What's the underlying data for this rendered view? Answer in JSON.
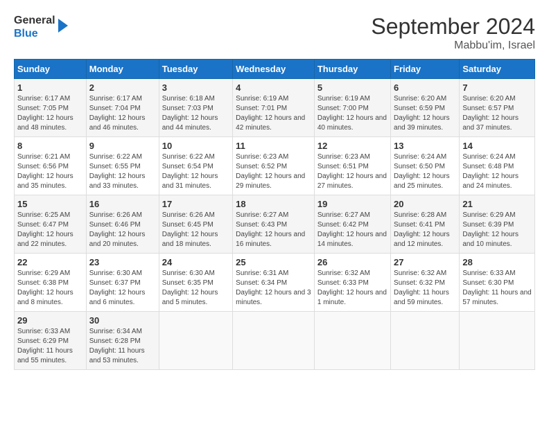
{
  "header": {
    "logo_line1": "General",
    "logo_line2": "Blue",
    "month_title": "September 2024",
    "location": "Mabbu'im, Israel"
  },
  "days_of_week": [
    "Sunday",
    "Monday",
    "Tuesday",
    "Wednesday",
    "Thursday",
    "Friday",
    "Saturday"
  ],
  "weeks": [
    [
      {
        "day": "1",
        "sunrise": "6:17 AM",
        "sunset": "7:05 PM",
        "daylight": "12 hours and 48 minutes."
      },
      {
        "day": "2",
        "sunrise": "6:17 AM",
        "sunset": "7:04 PM",
        "daylight": "12 hours and 46 minutes."
      },
      {
        "day": "3",
        "sunrise": "6:18 AM",
        "sunset": "7:03 PM",
        "daylight": "12 hours and 44 minutes."
      },
      {
        "day": "4",
        "sunrise": "6:19 AM",
        "sunset": "7:01 PM",
        "daylight": "12 hours and 42 minutes."
      },
      {
        "day": "5",
        "sunrise": "6:19 AM",
        "sunset": "7:00 PM",
        "daylight": "12 hours and 40 minutes."
      },
      {
        "day": "6",
        "sunrise": "6:20 AM",
        "sunset": "6:59 PM",
        "daylight": "12 hours and 39 minutes."
      },
      {
        "day": "7",
        "sunrise": "6:20 AM",
        "sunset": "6:57 PM",
        "daylight": "12 hours and 37 minutes."
      }
    ],
    [
      {
        "day": "8",
        "sunrise": "6:21 AM",
        "sunset": "6:56 PM",
        "daylight": "12 hours and 35 minutes."
      },
      {
        "day": "9",
        "sunrise": "6:22 AM",
        "sunset": "6:55 PM",
        "daylight": "12 hours and 33 minutes."
      },
      {
        "day": "10",
        "sunrise": "6:22 AM",
        "sunset": "6:54 PM",
        "daylight": "12 hours and 31 minutes."
      },
      {
        "day": "11",
        "sunrise": "6:23 AM",
        "sunset": "6:52 PM",
        "daylight": "12 hours and 29 minutes."
      },
      {
        "day": "12",
        "sunrise": "6:23 AM",
        "sunset": "6:51 PM",
        "daylight": "12 hours and 27 minutes."
      },
      {
        "day": "13",
        "sunrise": "6:24 AM",
        "sunset": "6:50 PM",
        "daylight": "12 hours and 25 minutes."
      },
      {
        "day": "14",
        "sunrise": "6:24 AM",
        "sunset": "6:48 PM",
        "daylight": "12 hours and 24 minutes."
      }
    ],
    [
      {
        "day": "15",
        "sunrise": "6:25 AM",
        "sunset": "6:47 PM",
        "daylight": "12 hours and 22 minutes."
      },
      {
        "day": "16",
        "sunrise": "6:26 AM",
        "sunset": "6:46 PM",
        "daylight": "12 hours and 20 minutes."
      },
      {
        "day": "17",
        "sunrise": "6:26 AM",
        "sunset": "6:45 PM",
        "daylight": "12 hours and 18 minutes."
      },
      {
        "day": "18",
        "sunrise": "6:27 AM",
        "sunset": "6:43 PM",
        "daylight": "12 hours and 16 minutes."
      },
      {
        "day": "19",
        "sunrise": "6:27 AM",
        "sunset": "6:42 PM",
        "daylight": "12 hours and 14 minutes."
      },
      {
        "day": "20",
        "sunrise": "6:28 AM",
        "sunset": "6:41 PM",
        "daylight": "12 hours and 12 minutes."
      },
      {
        "day": "21",
        "sunrise": "6:29 AM",
        "sunset": "6:39 PM",
        "daylight": "12 hours and 10 minutes."
      }
    ],
    [
      {
        "day": "22",
        "sunrise": "6:29 AM",
        "sunset": "6:38 PM",
        "daylight": "12 hours and 8 minutes."
      },
      {
        "day": "23",
        "sunrise": "6:30 AM",
        "sunset": "6:37 PM",
        "daylight": "12 hours and 6 minutes."
      },
      {
        "day": "24",
        "sunrise": "6:30 AM",
        "sunset": "6:35 PM",
        "daylight": "12 hours and 5 minutes."
      },
      {
        "day": "25",
        "sunrise": "6:31 AM",
        "sunset": "6:34 PM",
        "daylight": "12 hours and 3 minutes."
      },
      {
        "day": "26",
        "sunrise": "6:32 AM",
        "sunset": "6:33 PM",
        "daylight": "12 hours and 1 minute."
      },
      {
        "day": "27",
        "sunrise": "6:32 AM",
        "sunset": "6:32 PM",
        "daylight": "11 hours and 59 minutes."
      },
      {
        "day": "28",
        "sunrise": "6:33 AM",
        "sunset": "6:30 PM",
        "daylight": "11 hours and 57 minutes."
      }
    ],
    [
      {
        "day": "29",
        "sunrise": "6:33 AM",
        "sunset": "6:29 PM",
        "daylight": "11 hours and 55 minutes."
      },
      {
        "day": "30",
        "sunrise": "6:34 AM",
        "sunset": "6:28 PM",
        "daylight": "11 hours and 53 minutes."
      },
      null,
      null,
      null,
      null,
      null
    ]
  ]
}
